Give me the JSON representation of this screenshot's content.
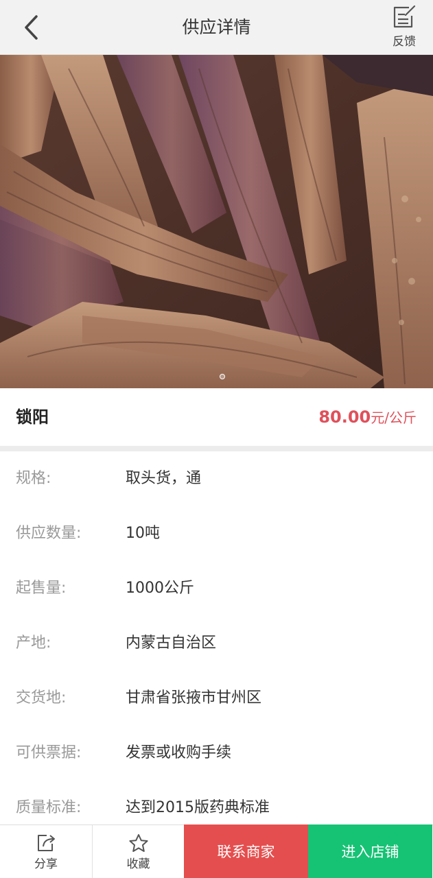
{
  "header": {
    "title": "供应详情",
    "back_icon": "chevron-left-icon",
    "feedback_label": "反馈",
    "feedback_icon": "edit-note-icon"
  },
  "product": {
    "name": "锁阳",
    "price_value": "80.00",
    "price_unit": "元/公斤",
    "price_color": "#e0505a"
  },
  "specs": [
    {
      "label": "规格:",
      "value": "取头货，通"
    },
    {
      "label": "供应数量:",
      "value": "10吨"
    },
    {
      "label": "起售量:",
      "value": "1000公斤"
    },
    {
      "label": "产地:",
      "value": "内蒙古自治区"
    },
    {
      "label": "交货地:",
      "value": "甘肃省张掖市甘州区"
    },
    {
      "label": "可供票据:",
      "value": "发票或收购手续"
    },
    {
      "label": "质量标准:",
      "value": "达到2015版药典标准"
    }
  ],
  "bottom_bar": {
    "share_label": "分享",
    "share_icon": "share-icon",
    "favorite_label": "收藏",
    "favorite_icon": "star-icon",
    "contact_label": "联系商家",
    "contact_color": "#e54e4e",
    "shop_label": "进入店铺",
    "shop_color": "#16c274"
  }
}
